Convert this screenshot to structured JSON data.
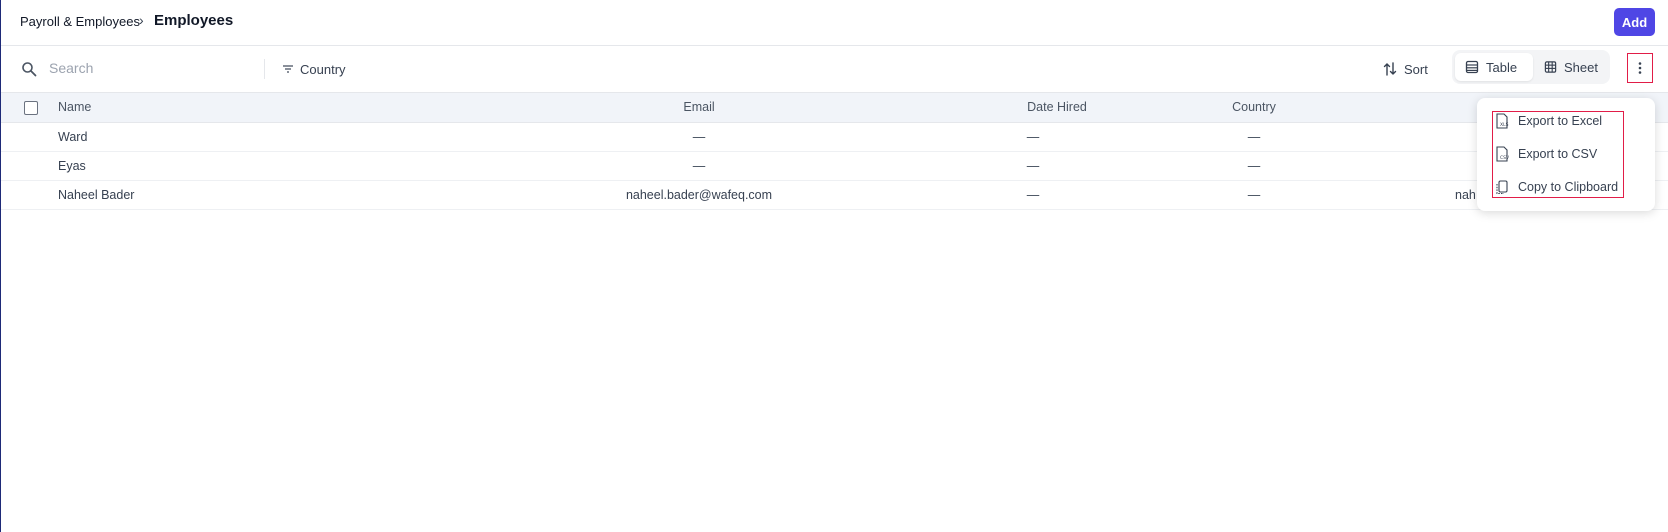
{
  "header": {
    "breadcrumb_parent": "Payroll & Employees",
    "breadcrumb_separator": "›",
    "title": "Employees",
    "add_label": "Add"
  },
  "toolbar": {
    "search_placeholder": "Search",
    "filter_label": "Country",
    "sort_label": "Sort",
    "view_options": [
      "Table",
      "Sheet"
    ],
    "selected_view": "Table"
  },
  "table": {
    "columns": [
      "Name",
      "Email",
      "Date Hired",
      "Country"
    ],
    "rows": [
      {
        "name": "Ward",
        "email": "—",
        "date_hired": "—",
        "country": "—",
        "extra": ""
      },
      {
        "name": "Eyas",
        "email": "—",
        "date_hired": "—",
        "country": "—",
        "extra": ""
      },
      {
        "name": "Naheel Bader",
        "email": "naheel.bader@wafeq.com",
        "date_hired": "—",
        "country": "—",
        "extra": "nah"
      }
    ]
  },
  "more_menu": {
    "items": [
      {
        "label": "Export to Excel",
        "icon": "xls-file-icon"
      },
      {
        "label": "Export to CSV",
        "icon": "csv-file-icon"
      },
      {
        "label": "Copy to Clipboard",
        "icon": "clipboard-icon"
      }
    ]
  },
  "colors": {
    "accent": "#4f46e5",
    "highlight_border": "#e11d48",
    "header_row_bg": "#f1f4f9"
  }
}
